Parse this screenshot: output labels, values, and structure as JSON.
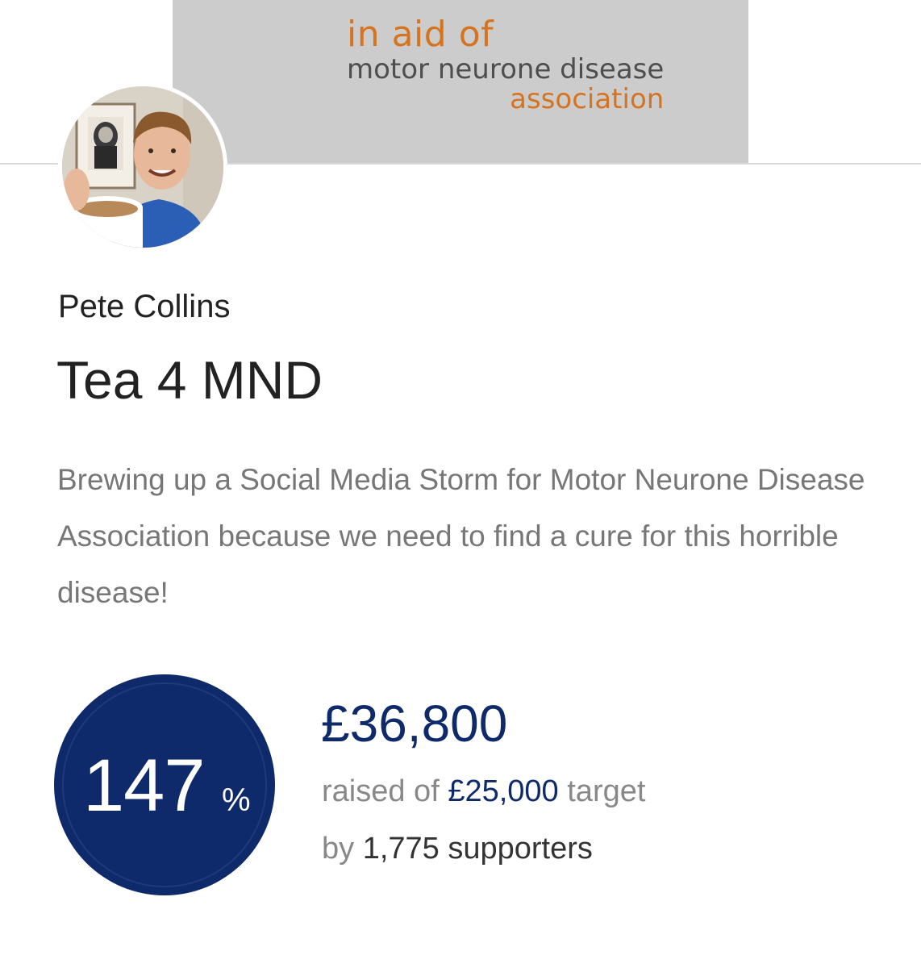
{
  "charity": {
    "line1": "in aid of",
    "line2": "motor neurone disease",
    "line3": "association",
    "colors": {
      "banner_bg": "#cccccc",
      "accent": "#d6731f",
      "text": "#4e4e4e"
    }
  },
  "fundraiser": {
    "name": "Pete Collins",
    "title": "Tea 4 MND",
    "description": "Brewing up a Social Media Storm for Motor Neurone Disease Association because we need to find a cure for this horrible disease!"
  },
  "progress": {
    "percent": "147",
    "percent_symbol": "%",
    "amount_raised": "£36,800",
    "raised_prefix": "raised of",
    "target": "£25,000",
    "target_suffix": "target",
    "supporters_prefix": "by",
    "supporters_count": "1,775",
    "supporters_suffix": "supporters",
    "colors": {
      "circle": "#0f2a6b"
    }
  }
}
